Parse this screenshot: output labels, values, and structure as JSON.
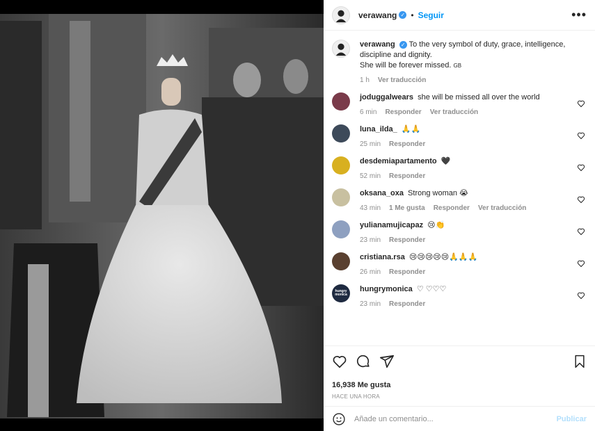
{
  "post": {
    "owner": "verawang",
    "follow_label": "Seguir",
    "dot": "•",
    "caption_line1": "To the very symbol of duty, grace, intelligence, discipline and dignity.",
    "caption_line2": "She will be forever missed.",
    "caption_flag": "GB",
    "caption_time": "1 h",
    "caption_translate": "Ver traducción",
    "likes": "16,938 Me gusta",
    "timestamp": "HACE UNA HORA"
  },
  "comments": [
    {
      "user": "joduggalwears",
      "text": "she will be missed all over the world",
      "time": "6 min",
      "likes": "",
      "reply": "Responder",
      "translate": "Ver traducción",
      "avatar_color": "#7a3b4a"
    },
    {
      "user": "luna_ilda_",
      "text": "🙏🙏",
      "time": "25 min",
      "likes": "",
      "reply": "Responder",
      "translate": "",
      "avatar_color": "#3d4a5a"
    },
    {
      "user": "desdemiapartamento",
      "text": "🖤",
      "time": "52 min",
      "likes": "",
      "reply": "Responder",
      "translate": "",
      "avatar_color": "#d8b020"
    },
    {
      "user": "oksana_oxa",
      "text": "Strong woman 😭",
      "time": "43 min",
      "likes": "1 Me gusta",
      "reply": "Responder",
      "translate": "Ver traducción",
      "avatar_color": "#c8c0a0"
    },
    {
      "user": "yulianamujicapaz",
      "text": "😢👏",
      "time": "23 min",
      "likes": "",
      "reply": "Responder",
      "translate": "",
      "avatar_color": "#8ea0c0"
    },
    {
      "user": "cristiana.rsa",
      "text": "😢😢😢😢😢🙏🙏🙏",
      "time": "26 min",
      "likes": "",
      "reply": "Responder",
      "translate": "",
      "avatar_color": "#5a4030"
    },
    {
      "user": "hungrymonica",
      "text": "♡ ♡♡♡",
      "time": "23 min",
      "likes": "",
      "reply": "Responder",
      "translate": "",
      "avatar_color": "#1e2a40",
      "avatar_text": "hungry monica"
    }
  ],
  "comment_box": {
    "placeholder": "Añade un comentario...",
    "publish_label": "Publicar"
  },
  "colors": {
    "link_blue": "#0095f6",
    "muted": "#8e8e8e",
    "publish_disabled": "#b2dffc"
  },
  "icons": [
    "heart-icon",
    "comment-icon",
    "share-icon",
    "bookmark-icon",
    "emoji-icon",
    "more-icon",
    "verified-icon"
  ]
}
